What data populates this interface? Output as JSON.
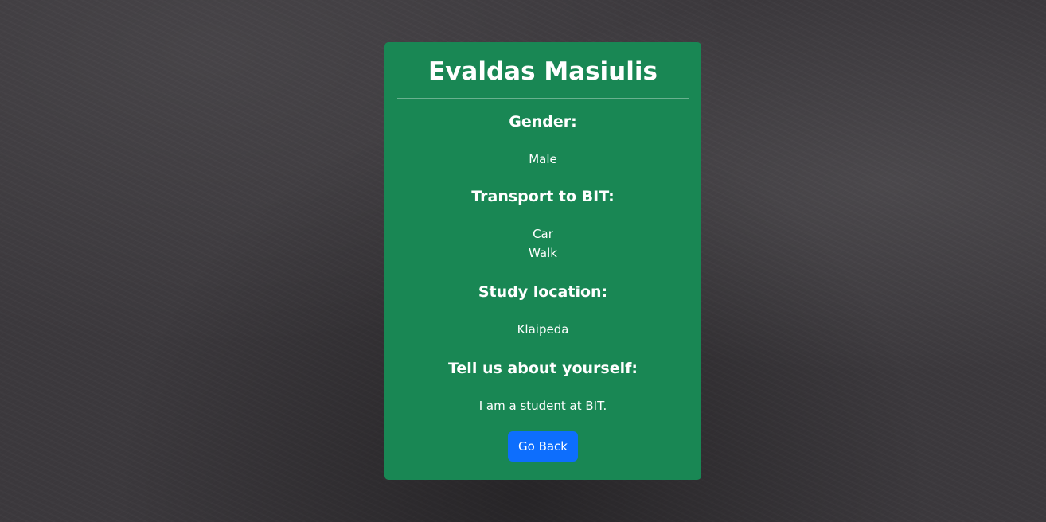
{
  "profile": {
    "name": "Evaldas Masiulis",
    "sections": [
      {
        "title": "Gender:",
        "values": [
          "Male"
        ]
      },
      {
        "title": "Transport to BIT:",
        "values": [
          "Car",
          "Walk"
        ]
      },
      {
        "title": "Study location:",
        "values": [
          "Klaipeda"
        ]
      },
      {
        "title": "Tell us about yourself:",
        "values": [
          "I am a student at BIT."
        ]
      }
    ],
    "back_label": "Go Back"
  },
  "colors": {
    "card_background": "#198754",
    "button_background": "#0d6efd",
    "page_background": "#3b383c",
    "text": "#ffffff"
  }
}
